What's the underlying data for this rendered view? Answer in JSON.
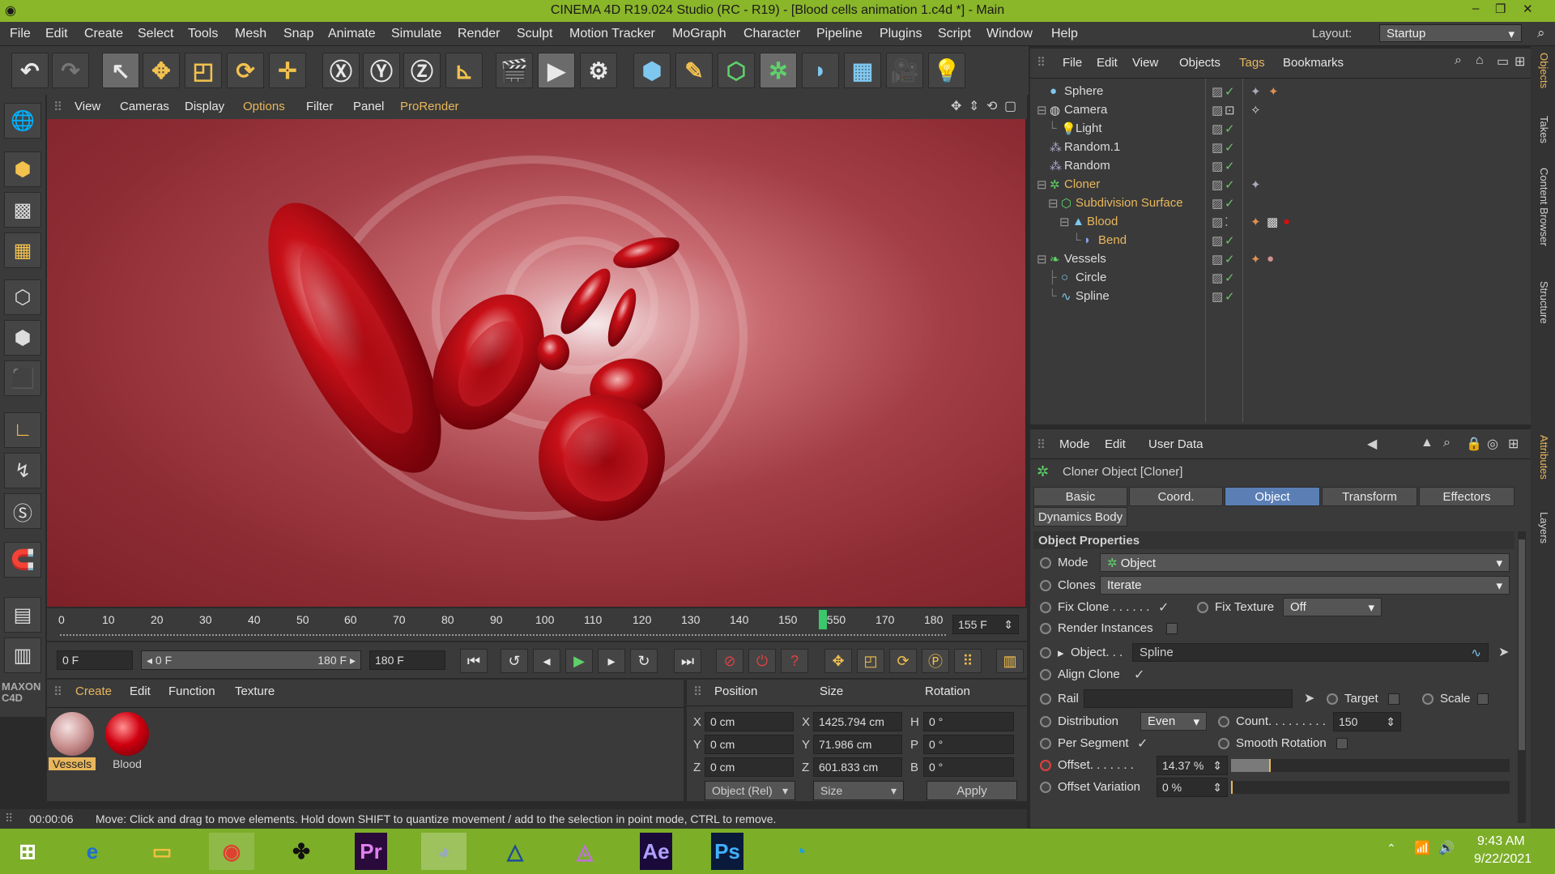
{
  "window": {
    "title": "CINEMA 4D R19.024 Studio (RC - R19) - [Blood cells animation 1.c4d *] - Main"
  },
  "menu": [
    "File",
    "Edit",
    "Create",
    "Select",
    "Tools",
    "Mesh",
    "Snap",
    "Animate",
    "Simulate",
    "Render",
    "Sculpt",
    "Motion Tracker",
    "MoGraph",
    "Character",
    "Pipeline",
    "Plugins",
    "Script",
    "Window",
    "Help"
  ],
  "layout": {
    "label": "Layout:",
    "value": "Startup"
  },
  "viewport_menu": [
    "View",
    "Cameras",
    "Display",
    "Options",
    "Filter",
    "Panel",
    "ProRender"
  ],
  "timeline": {
    "ticks": [
      "0",
      "10",
      "20",
      "30",
      "40",
      "50",
      "60",
      "70",
      "80",
      "90",
      "100",
      "110",
      "120",
      "130",
      "140",
      "150",
      "1550",
      "170",
      "180"
    ],
    "current": "155 F",
    "progress": 0.861
  },
  "transport": {
    "start": "0 F",
    "range_start": "0 F",
    "range_end": "180 F",
    "end": "180 F"
  },
  "material_menu": [
    "Create",
    "Edit",
    "Function",
    "Texture"
  ],
  "materials": [
    {
      "name": "Vessels"
    },
    {
      "name": "Blood"
    }
  ],
  "coords": {
    "headers": [
      "Position",
      "Size",
      "Rotation"
    ],
    "rows": [
      {
        "axis": "X",
        "pos": "0 cm",
        "saxis": "X",
        "size": "1425.794 cm",
        "raxis": "H",
        "rot": "0 °"
      },
      {
        "axis": "Y",
        "pos": "0 cm",
        "saxis": "Y",
        "size": "71.986 cm",
        "raxis": "P",
        "rot": "0 °"
      },
      {
        "axis": "Z",
        "pos": "0 cm",
        "saxis": "Z",
        "size": "601.833 cm",
        "raxis": "B",
        "rot": "0 °"
      }
    ],
    "mode": "Object (Rel)",
    "size_mode": "Size",
    "apply": "Apply"
  },
  "status": {
    "time": "00:00:06",
    "message": "Move: Click and drag to move elements. Hold down SHIFT to quantize movement / add to the selection in point mode, CTRL to remove."
  },
  "objmgr_menu": [
    "File",
    "Edit",
    "View",
    "Objects",
    "Tags",
    "Bookmarks"
  ],
  "objects": [
    {
      "name": "Sphere"
    },
    {
      "name": "Camera"
    },
    {
      "name": "Light"
    },
    {
      "name": "Random.1"
    },
    {
      "name": "Random"
    },
    {
      "name": "Cloner"
    },
    {
      "name": "Subdivision Surface"
    },
    {
      "name": "Blood"
    },
    {
      "name": "Bend"
    },
    {
      "name": "Vessels"
    },
    {
      "name": "Circle"
    },
    {
      "name": "Spline"
    }
  ],
  "attr_menu": [
    "Mode",
    "Edit",
    "User Data"
  ],
  "attr": {
    "title": "Cloner Object [Cloner]",
    "tabs": [
      "Basic",
      "Coord.",
      "Object",
      "Transform",
      "Effectors"
    ],
    "tab2": "Dynamics Body",
    "section": "Object Properties",
    "mode_label": "Mode",
    "mode_value": "Object",
    "clones_label": "Clones",
    "clones_value": "Iterate",
    "fixclone_label": "Fix Clone . . . . . .",
    "fixtexture_label": "Fix Texture",
    "fixtexture_value": "Off",
    "renderinst_label": "Render Instances",
    "object_label": "Object. . .",
    "object_value": "Spline",
    "alignclone_label": "Align Clone",
    "rail_label": "Rail",
    "target_label": "Target",
    "scale_label": "Scale",
    "dist_label": "Distribution",
    "dist_value": "Even",
    "count_label": "Count. . . . . . . . .",
    "count_value": "150",
    "perseg_label": "Per Segment",
    "smoothrot_label": "Smooth Rotation",
    "offset_label": "Offset. . . . . . .",
    "offset_value": "14.37 %",
    "offset_fraction": 0.1437,
    "offvar_label": "Offset Variation",
    "offvar_value": "0 %"
  },
  "right_tabs": [
    "Objects",
    "Takes",
    "Content Browser",
    "Structure",
    "Attributes",
    "Layers"
  ],
  "taskbar": {
    "time": "9:43 AM",
    "date": "9/22/2021"
  }
}
